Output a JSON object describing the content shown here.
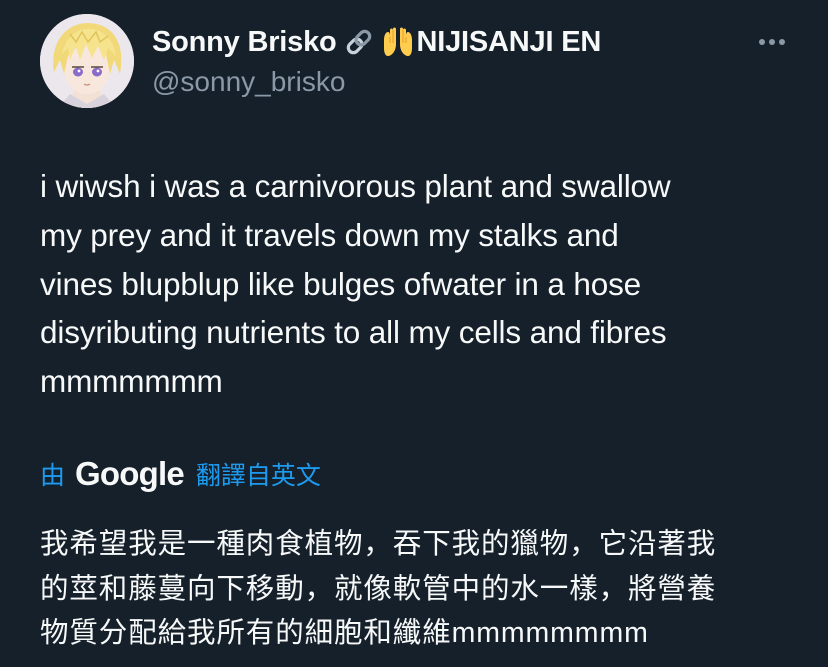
{
  "author": {
    "display_name": "Sonny Brisko",
    "link_emoji": "🔗",
    "hands_emoji": "🙌",
    "name_suffix": "NIJISANJI EN",
    "handle": "@sonny_brisko",
    "avatar_icon": "anime-avatar-blond-hair"
  },
  "more_icon": "more-horizontal-icon",
  "tweet": {
    "lines": [
      "i wiwsh i was a carnivorous plant and swallow",
      "my prey and it travels down my stalks and",
      "vines blupblup like bulges ofwater in a hose",
      "disyributing nutrients to all my cells and fibres",
      "mmmmmmm"
    ]
  },
  "translation": {
    "by_label": "由",
    "provider": "Google",
    "from_label": "翻譯自英文",
    "lines": [
      "我希望我是一種肉食植物，吞下我的獵物，它沿著我",
      "的莖和藤蔓向下移動，就像軟管中的水一樣，將營養",
      "物質分配給我所有的細胞和纖維mmmmmmmm"
    ]
  },
  "colors": {
    "background": "#15202b",
    "text": "#f7f9f9",
    "secondary": "#8b98a5",
    "accent": "#1d9bf0"
  }
}
